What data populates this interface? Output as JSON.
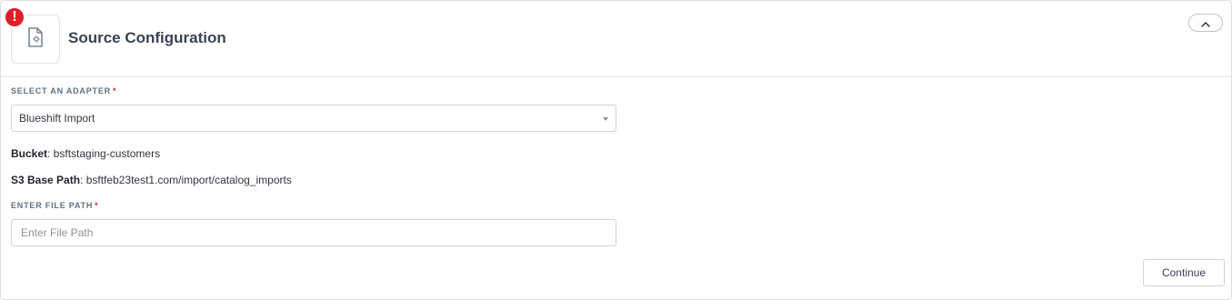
{
  "panel": {
    "title": "Source Configuration",
    "alert_glyph": "!",
    "icons": {
      "section": "file-settings-icon",
      "alert": "error-badge-icon",
      "collapse": "chevron-up-icon"
    },
    "colors": {
      "alert": "#e01e2b",
      "label": "#5e7383",
      "title": "#3a4351"
    }
  },
  "adapter": {
    "label": "SELECT AN ADAPTER",
    "required_mark": "*",
    "selected": "Blueshift Import"
  },
  "info": {
    "bucket_label": "Bucket",
    "bucket_value": ": bsftstaging-customers",
    "s3_label": "S3 Base Path",
    "s3_value": ": bsftfeb23test1.com/import/catalog_imports"
  },
  "file_path": {
    "label": "ENTER FILE PATH",
    "required_mark": "*",
    "value": "",
    "placeholder": "Enter File Path"
  },
  "actions": {
    "continue_label": "Continue"
  }
}
